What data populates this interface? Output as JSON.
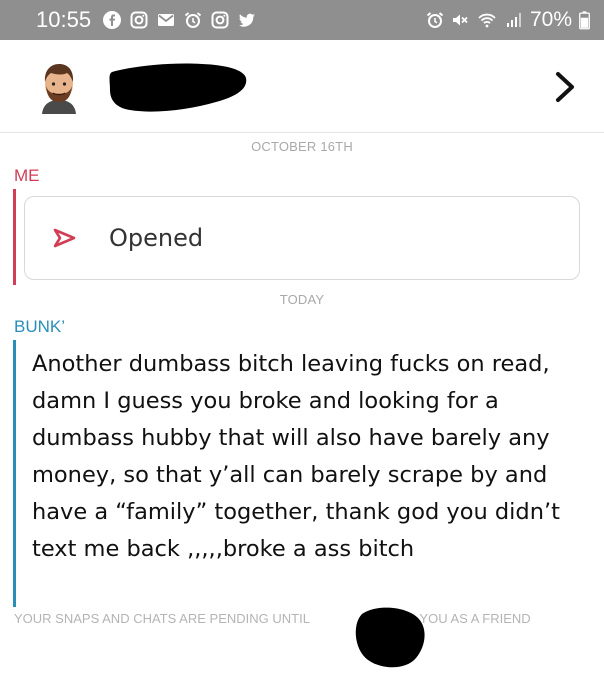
{
  "status_bar": {
    "time": "10:55",
    "battery": "70%",
    "icons_left": [
      "facebook-icon",
      "instagram-icon",
      "gmail-icon",
      "alarm-icon",
      "instagram-icon",
      "twitter-icon"
    ],
    "icons_right": [
      "alarm-icon",
      "mute-icon",
      "wifi-icon",
      "signal-icon",
      "battery-icon"
    ]
  },
  "header": {
    "avatar_icon": "bitmoji-avatar",
    "forward_icon": "chevron-right-icon"
  },
  "chat": {
    "date_1": "OCTOBER 16TH",
    "sender_me": "ME",
    "opened_label": "Opened",
    "date_2": "TODAY",
    "sender_bunk": "BUNK’",
    "message": "Another dumbass bitch leaving fucks on read, damn I guess you broke and looking for a dumbass hubby that will also have barely any money, so that y’all can barely scrape by and have a “family” together, thank god you didn’t text me back ,,,,,broke a ass bitch",
    "pending_note": "YOUR SNAPS AND CHATS ARE PENDING UNTIL",
    "pending_note_end": "ADDS YOU AS A FRIEND"
  },
  "colors": {
    "me": "#d03d55",
    "bunk": "#2a8fb8",
    "status_bar": "#8f8f8f"
  }
}
